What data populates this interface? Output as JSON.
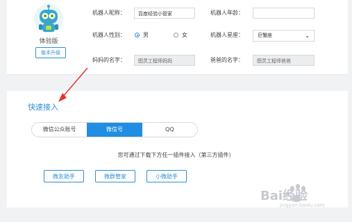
{
  "profile": {
    "version": "体验版",
    "upgrade_label": "版本升级",
    "nickname_label": "机器人昵称：",
    "nickname_value": "百度经验小管家",
    "age_label": "机器人年龄：",
    "age_value": "",
    "gender_label": "机器人性别：",
    "gender_options": [
      "男",
      "女"
    ],
    "gender_selected": "男",
    "constellation_label": "机器人星座：",
    "constellation_value": "巨蟹座",
    "mother_label": "妈妈的名字：",
    "mother_value": "图灵工程师妈妈",
    "father_label": "爸爸的名字：",
    "father_value": "图灵工程师爸爸"
  },
  "quick_access": {
    "title": "快速接入",
    "tabs": [
      "微信公众账号",
      "微信号",
      "QQ"
    ],
    "active_tab": "微信号",
    "hint": "您可通过下载下方任一插件接入（第三方插件）",
    "plugins": [
      "微友助手",
      "微群管家",
      "小微助手"
    ]
  },
  "watermark": {
    "text": "Bai经验",
    "sub": "jingyan.baidu.com"
  },
  "colors": {
    "accent": "#2d8fd5",
    "tab_active": "#1f8ee3",
    "arrow": "#e8332a",
    "robot_body": "#3aa6c8",
    "robot_eye": "#b6e24a"
  }
}
